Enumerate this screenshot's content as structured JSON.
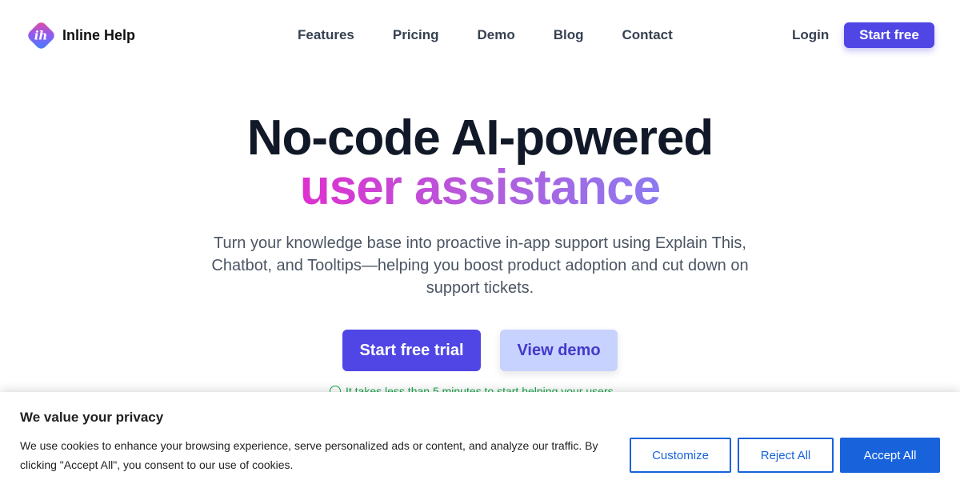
{
  "brand": {
    "name": "Inline Help",
    "logo_letters": "ih"
  },
  "nav": {
    "links": [
      "Features",
      "Pricing",
      "Demo",
      "Blog",
      "Contact"
    ],
    "login": "Login",
    "start_free": "Start free"
  },
  "hero": {
    "title_line1": "No-code AI-powered",
    "title_line2": "user assistance",
    "subtitle": "Turn your knowledge base into proactive in-app support using Explain This, Chatbot, and Tooltips—helping you boost product adoption and cut down on support tickets.",
    "cta_primary": "Start free trial",
    "cta_secondary": "View demo",
    "note": "It takes less than 5 minutes to start helping your users"
  },
  "cookie": {
    "title": "We value your privacy",
    "text": "We use cookies to enhance your browsing experience, serve personalized ads or content, and analyze our traffic. By clicking \"Accept All\", you consent to our use of cookies.",
    "customize": "Customize",
    "reject": "Reject All",
    "accept": "Accept All"
  },
  "colors": {
    "primary": "#4f46e5",
    "cookie_blue": "#1863dc",
    "note_green": "#16a34a"
  }
}
